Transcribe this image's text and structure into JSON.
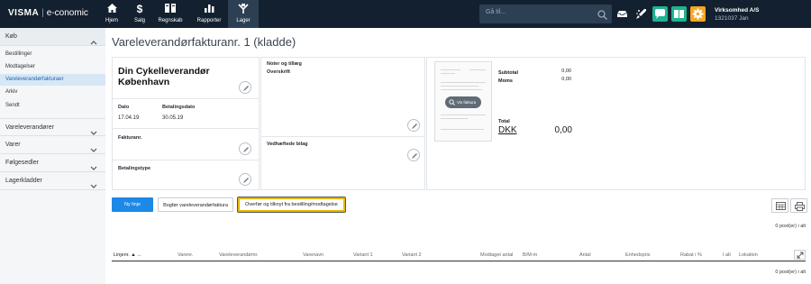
{
  "topbar": {
    "brand": "VISMA",
    "product": "e-conomic",
    "nav": [
      {
        "label": "Hjem",
        "icon": "home-icon"
      },
      {
        "label": "Salg",
        "icon": "dollar-icon"
      },
      {
        "label": "Regnskab",
        "icon": "ledger-icon"
      },
      {
        "label": "Rapporter",
        "icon": "bar-chart-icon"
      },
      {
        "label": "Lager",
        "icon": "warehouse-icon"
      }
    ],
    "search_placeholder": "Gå til...",
    "company_name": "Virksomhed A/S",
    "company_sub": "1321037 Jan",
    "colors": {
      "bar": "#13202f",
      "chat": "#1fb390",
      "book": "#1fb390",
      "settings": "#f5a623"
    }
  },
  "sidebar": {
    "sections": [
      {
        "label": "Køb",
        "open": true
      },
      {
        "label": "Vareleverandører",
        "open": false
      },
      {
        "label": "Varer",
        "open": false
      },
      {
        "label": "Følgesedler",
        "open": false
      },
      {
        "label": "Lagerkladder",
        "open": false
      }
    ],
    "items": [
      "Bestillinger",
      "Modtagelser",
      "Vareleverandørfakturaer",
      "Arkiv",
      "Sendt"
    ],
    "active_item": "Vareleverandørfakturaer"
  },
  "page": {
    "title": "Vareleverandørfakturanr. 1 (kladde)",
    "supplier": "Din Cykelleverandør København",
    "dato_label": "Dato",
    "dato_value": "17.04.19",
    "betalingsdato_label": "Betalingsdato",
    "betalingsdato_value": "30.05.19",
    "fakturanr_label": "Fakturanr.",
    "betalingstype_label": "Betalingstype",
    "noter_label": "Noter og tillæg",
    "overskrift_label": "Overskrift",
    "vedhaeftede_label": "Vedhæftede bilag",
    "vis_faktura": "Vis faktura",
    "subtotal_label": "Subtotal",
    "subtotal_value": "0,00",
    "moms_label": "Moms",
    "moms_value": "0,00",
    "total_label": "Total",
    "currency": "DKK",
    "total_value": "0,00"
  },
  "actions": {
    "new_line": "Ny linje",
    "book": "Bogfør vareleverandørfaktura",
    "transfer": "Overfør og tilknyt fra bestilling/modtagelse"
  },
  "table": {
    "count_top": "0 post(er) i alt",
    "count_bottom": "0 post(er) i alt",
    "columns": [
      "Linjenr. ▲ ...",
      "Varenr.",
      "Vareleverandørnr.",
      "Varenavn",
      "Variant 1",
      "Variant 2",
      "Modtaget antal",
      "B/M-m",
      "Antal",
      "Enhedspris",
      "Rabat i %",
      "I alt",
      "Lokation"
    ]
  }
}
